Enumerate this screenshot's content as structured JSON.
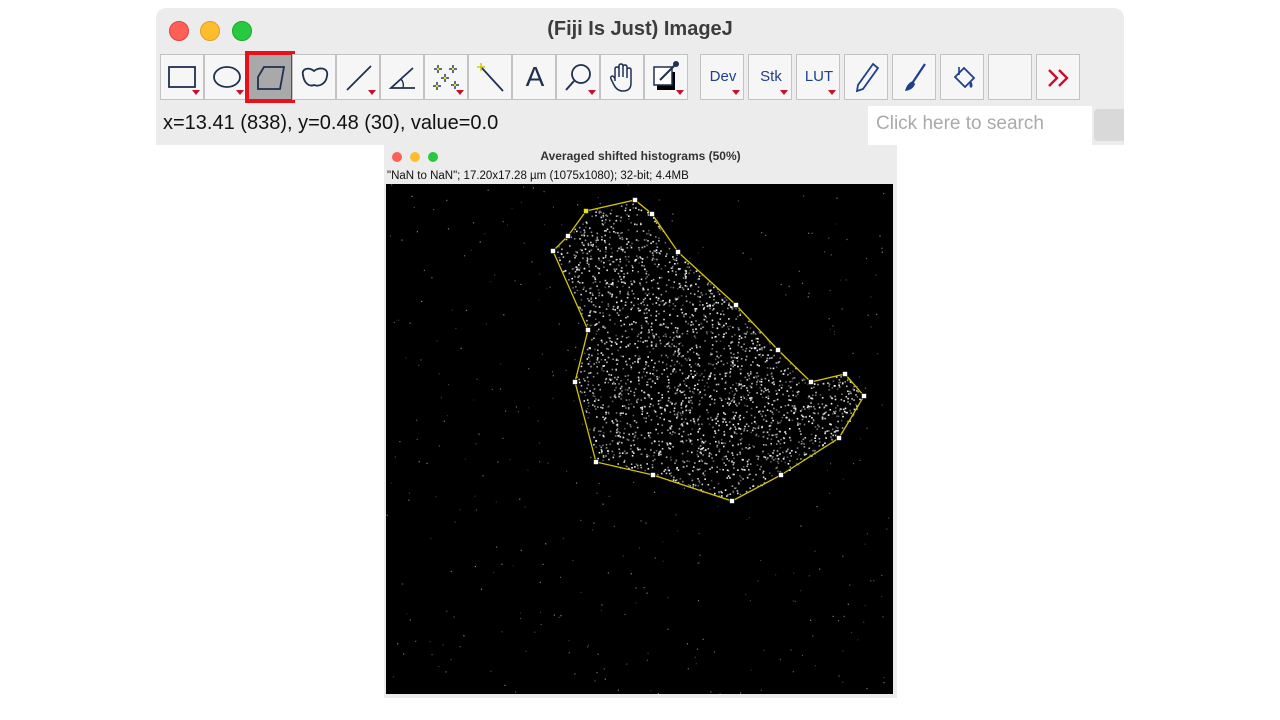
{
  "main_window": {
    "title": "(Fiji Is Just) ImageJ",
    "status_text": "x=13.41 (838), y=0.48 (30), value=0.0",
    "search_placeholder": "Click here to search"
  },
  "toolbar": {
    "tools": [
      {
        "name": "rectangle-tool",
        "icon": "rectangle-icon",
        "has_menu": true
      },
      {
        "name": "oval-tool",
        "icon": "oval-icon",
        "has_menu": true
      },
      {
        "name": "polygon-tool",
        "icon": "polygon-icon",
        "selected": true
      },
      {
        "name": "freehand-tool",
        "icon": "freehand-icon"
      },
      {
        "name": "line-tool",
        "icon": "line-icon",
        "has_menu": true
      },
      {
        "name": "angle-tool",
        "icon": "angle-icon"
      },
      {
        "name": "point-tool",
        "icon": "multipoint-icon",
        "has_menu": true
      },
      {
        "name": "wand-tool",
        "icon": "wand-icon"
      },
      {
        "name": "text-tool",
        "icon": "text-icon"
      },
      {
        "name": "magnifier-tool",
        "icon": "magnifier-icon",
        "has_menu": true
      },
      {
        "name": "hand-tool",
        "icon": "hand-icon"
      },
      {
        "name": "color-picker-tool",
        "icon": "color-picker-icon",
        "has_menu": true
      },
      {
        "name": "dev-menu",
        "label": "Dev",
        "has_menu": true
      },
      {
        "name": "stk-menu",
        "label": "Stk",
        "has_menu": true
      },
      {
        "name": "lut-menu",
        "label": "LUT",
        "has_menu": true
      },
      {
        "name": "pencil-tool",
        "icon": "pencil-icon"
      },
      {
        "name": "brush-tool",
        "icon": "brush-icon"
      },
      {
        "name": "flood-fill-tool",
        "icon": "flood-fill-icon"
      },
      {
        "name": "empty-slot"
      },
      {
        "name": "more-tools",
        "icon": "double-chevron-right-icon"
      }
    ],
    "dev_label": "Dev",
    "stk_label": "Stk",
    "lut_label": "LUT",
    "text_tool_glyph": "A"
  },
  "image_window": {
    "title": "Averaged shifted histograms (50%)",
    "info": "\"NaN to NaN\"; 17.20x17.28 µm (1075x1080); 32-bit; 4.4MB"
  },
  "colors": {
    "selection_highlight": "#e8101a",
    "roi_outline": "#d4c600",
    "menu_arrow": "#c8102e",
    "label_blue": "#1f3f8c"
  }
}
